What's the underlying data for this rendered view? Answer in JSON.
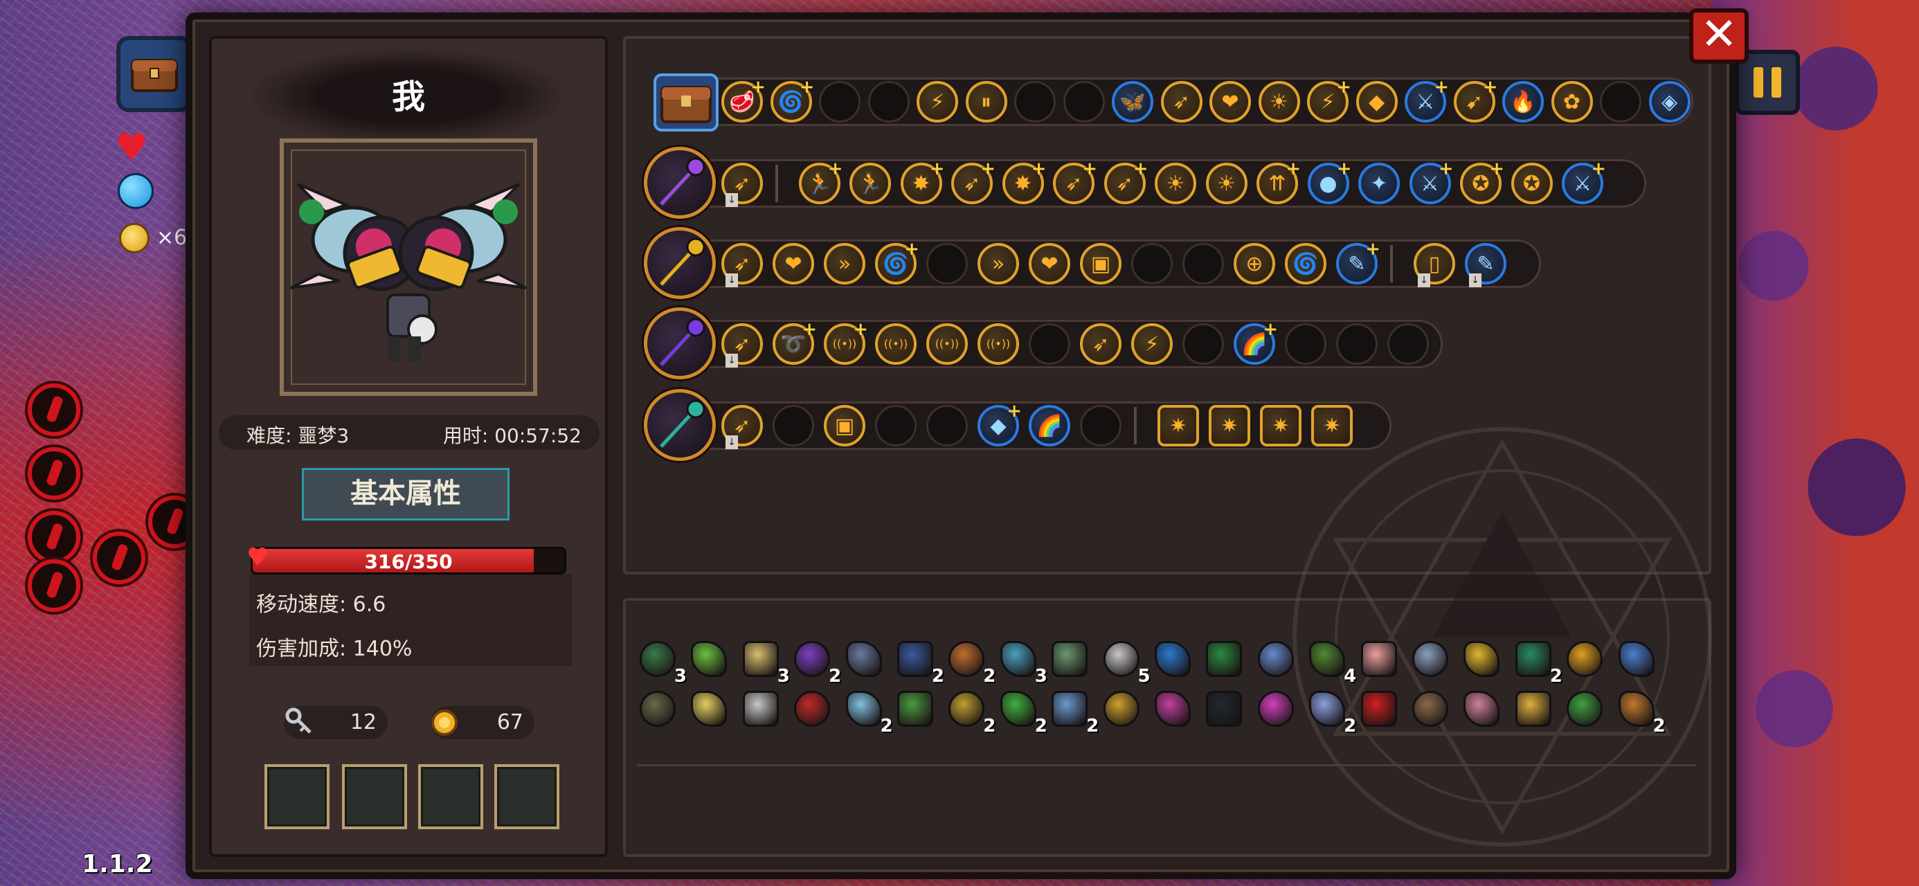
{
  "version": "1.1.2",
  "character": {
    "name": "我",
    "difficulty": "难度: 噩梦3",
    "playtime": "用时: 00:57:52"
  },
  "basic_attributes": {
    "title": "基本属性",
    "hp_text": "316/350",
    "hp_current": 316,
    "hp_max": 350,
    "move_speed": "移动速度: 6.6",
    "damage_bonus": "伤害加成: 140%"
  },
  "currency": {
    "keys": "12",
    "coins": "67"
  },
  "hud": {
    "coin_multiplier": "×6"
  },
  "colors": {
    "hp_fill": "#c81e1e",
    "gold_rim": "#e0a22a",
    "blue_rim": "#2a7ae0",
    "panel": "#2d2424",
    "close_button": "#c0221a"
  },
  "weapon_rows": [
    {
      "weapon": "backpack-icon",
      "slots": 20
    },
    {
      "weapon": "purple-staff-icon",
      "slots": 17
    },
    {
      "weapon": "crystal-sword-icon",
      "slots": 15
    },
    {
      "weapon": "star-wand-icon",
      "slots": 14
    },
    {
      "weapon": "orb-scepter-icon",
      "slots": 12
    }
  ],
  "inventory_counts": {
    "row1": [
      "3",
      "",
      "3",
      "2",
      "",
      "2",
      "2",
      "3",
      "",
      "5",
      "",
      "",
      "",
      "4",
      "",
      "",
      "",
      "2",
      "",
      ""
    ],
    "row2": [
      "",
      "",
      "",
      "",
      "2",
      "",
      "2",
      "2",
      "2",
      "",
      "",
      "",
      "",
      "2",
      "",
      "",
      "",
      "",
      "",
      "2"
    ]
  }
}
